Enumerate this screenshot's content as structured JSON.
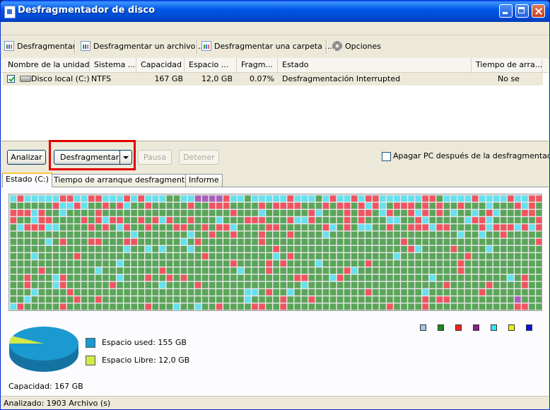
{
  "window": {
    "title": "Desfragmentador de disco"
  },
  "toolbar": {
    "defrag": "Desfragmentar",
    "defrag_file": "Desfragmentar un archivo ...",
    "defrag_folder": "Desfragmentar una carpeta ...",
    "options": "Opciones"
  },
  "list": {
    "columns": [
      "Nombre de la unidad",
      "Sistema ...",
      "Capacidad",
      "Espacio ...",
      "Fragm...",
      "Estado",
      "Tiempo de arra..."
    ],
    "rows": [
      {
        "name": "Disco local (C:)",
        "fs": "NTFS",
        "capacity": "167 GB",
        "free": "12,0 GB",
        "frag": "0.07%",
        "status": "Desfragmentación Interrupted",
        "boot": "No se"
      }
    ]
  },
  "actions": {
    "analyze": "Analizar",
    "defrag": "Desfragmentar",
    "pause": "Pausa",
    "stop": "Detener",
    "shutdown": "Apagar PC después de la desfragmentación"
  },
  "tabs": [
    "Estado (C:)",
    "Tiempo de arranque desfragmentado",
    "Informe"
  ],
  "legend_colors": [
    "#a8c4e8",
    "#1e8a1e",
    "#ee2222",
    "#8a1e8a",
    "#33e8f0",
    "#f0f000",
    "#1010e0"
  ],
  "map_colors": {
    "used": "#5aa55a",
    "frag": "#ee5560",
    "free": "#66e0ee",
    "system": "#a860b8"
  },
  "disk": {
    "used_label": "Espacio used: 155 GB",
    "free_label": "Espacio Libre: 12,0 GB",
    "capacity_label": "Capacidad: 167 GB",
    "used_color": "#1a9ad0",
    "free_color": "#d4e84a",
    "used_gb": 155,
    "free_gb": 12.0
  },
  "status": {
    "text": "Analizado: 1903 Archivo (s)"
  }
}
